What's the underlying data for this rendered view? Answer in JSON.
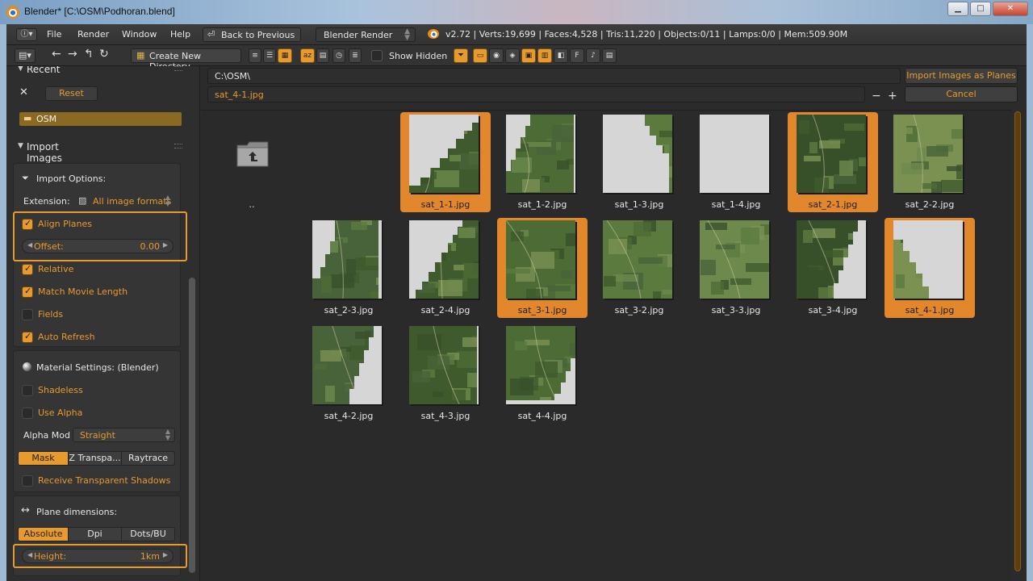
{
  "window": {
    "title": "Blender* [C:\\OSM\\Podhoran.blend]",
    "btn_min": "▁",
    "btn_max": "□",
    "btn_close": "✕"
  },
  "menubar": {
    "info_icon": "ⓘ▾",
    "items": [
      "File",
      "Render",
      "Window",
      "Help"
    ],
    "back_icon": "⏎",
    "back_label": "Back to Previous",
    "render_engine": "Blender Render",
    "stats": "v2.72 | Verts:19,699 | Faces:4,528 | Tris:11,220 | Objects:0/11 | Lamps:0/0 | Mem:509.90M"
  },
  "toolbar": {
    "editor_icon": "▤▾",
    "nav_glyphs": [
      "←",
      "→",
      "↰",
      "↻"
    ],
    "create_dir_icon": "▦",
    "create_dir_label": "Create New Directory",
    "show_hidden_label": "Show Hidden"
  },
  "left_panel": {
    "recent_header": "Recent",
    "reset_label": "Reset",
    "close_icon": "✕",
    "recent_item": "OSM",
    "import_header": "Import Images as Planes",
    "import_options_label": "Import Options:",
    "extension_label": "Extension:",
    "extension_value": "All image formats",
    "align_planes": "Align Planes",
    "offset_label": "Offset:",
    "offset_value": "0.00",
    "relative": "Relative",
    "match_movie_length": "Match Movie Length",
    "fields": "Fields",
    "auto_refresh": "Auto Refresh",
    "material_settings": "Material Settings: (Blender)",
    "shadeless": "Shadeless",
    "use_alpha": "Use Alpha",
    "alpha_mode_label": "Alpha Mod",
    "alpha_mode_value": "Straight",
    "mask_seg": [
      "Mask",
      "Z Transpa...",
      "Raytrace"
    ],
    "receive_shadows": "Receive Transparent Shadows",
    "plane_dimensions": "Plane dimensions:",
    "dim_seg": [
      "Absolute",
      "Dpi",
      "Dots/BU"
    ],
    "height_label": "Height:",
    "height_value": "1km",
    "checks": {
      "align_planes": true,
      "relative": true,
      "match_movie_length": true,
      "fields": false,
      "auto_refresh": true,
      "shadeless": false,
      "use_alpha": false,
      "receive_shadows": false
    }
  },
  "main": {
    "directory": "C:\\OSM\\",
    "filename": "sat_4-1.jpg",
    "import_button": "Import Images as Planes",
    "cancel_button": "Cancel",
    "minus": "−",
    "plus": "+",
    "parent_label": "..",
    "files": [
      {
        "name": "sat_1-1.jpg",
        "selected": true
      },
      {
        "name": "sat_1-2.jpg",
        "selected": false
      },
      {
        "name": "sat_1-3.jpg",
        "selected": false
      },
      {
        "name": "sat_1-4.jpg",
        "selected": false
      },
      {
        "name": "sat_2-1.jpg",
        "selected": true
      },
      {
        "name": "sat_2-2.jpg",
        "selected": false
      },
      {
        "name": "sat_2-3.jpg",
        "selected": false
      },
      {
        "name": "sat_2-4.jpg",
        "selected": false
      },
      {
        "name": "sat_3-1.jpg",
        "selected": true
      },
      {
        "name": "sat_3-2.jpg",
        "selected": false
      },
      {
        "name": "sat_3-3.jpg",
        "selected": false
      },
      {
        "name": "sat_3-4.jpg",
        "selected": false
      },
      {
        "name": "sat_4-1.jpg",
        "selected": true
      },
      {
        "name": "sat_4-2.jpg",
        "selected": false
      },
      {
        "name": "sat_4-3.jpg",
        "selected": false
      },
      {
        "name": "sat_4-4.jpg",
        "selected": false
      }
    ]
  },
  "colors": {
    "accent": "#e79a2d",
    "selected_cell": "#e2872b",
    "panel": "#353535",
    "background": "#2b2b2b"
  }
}
